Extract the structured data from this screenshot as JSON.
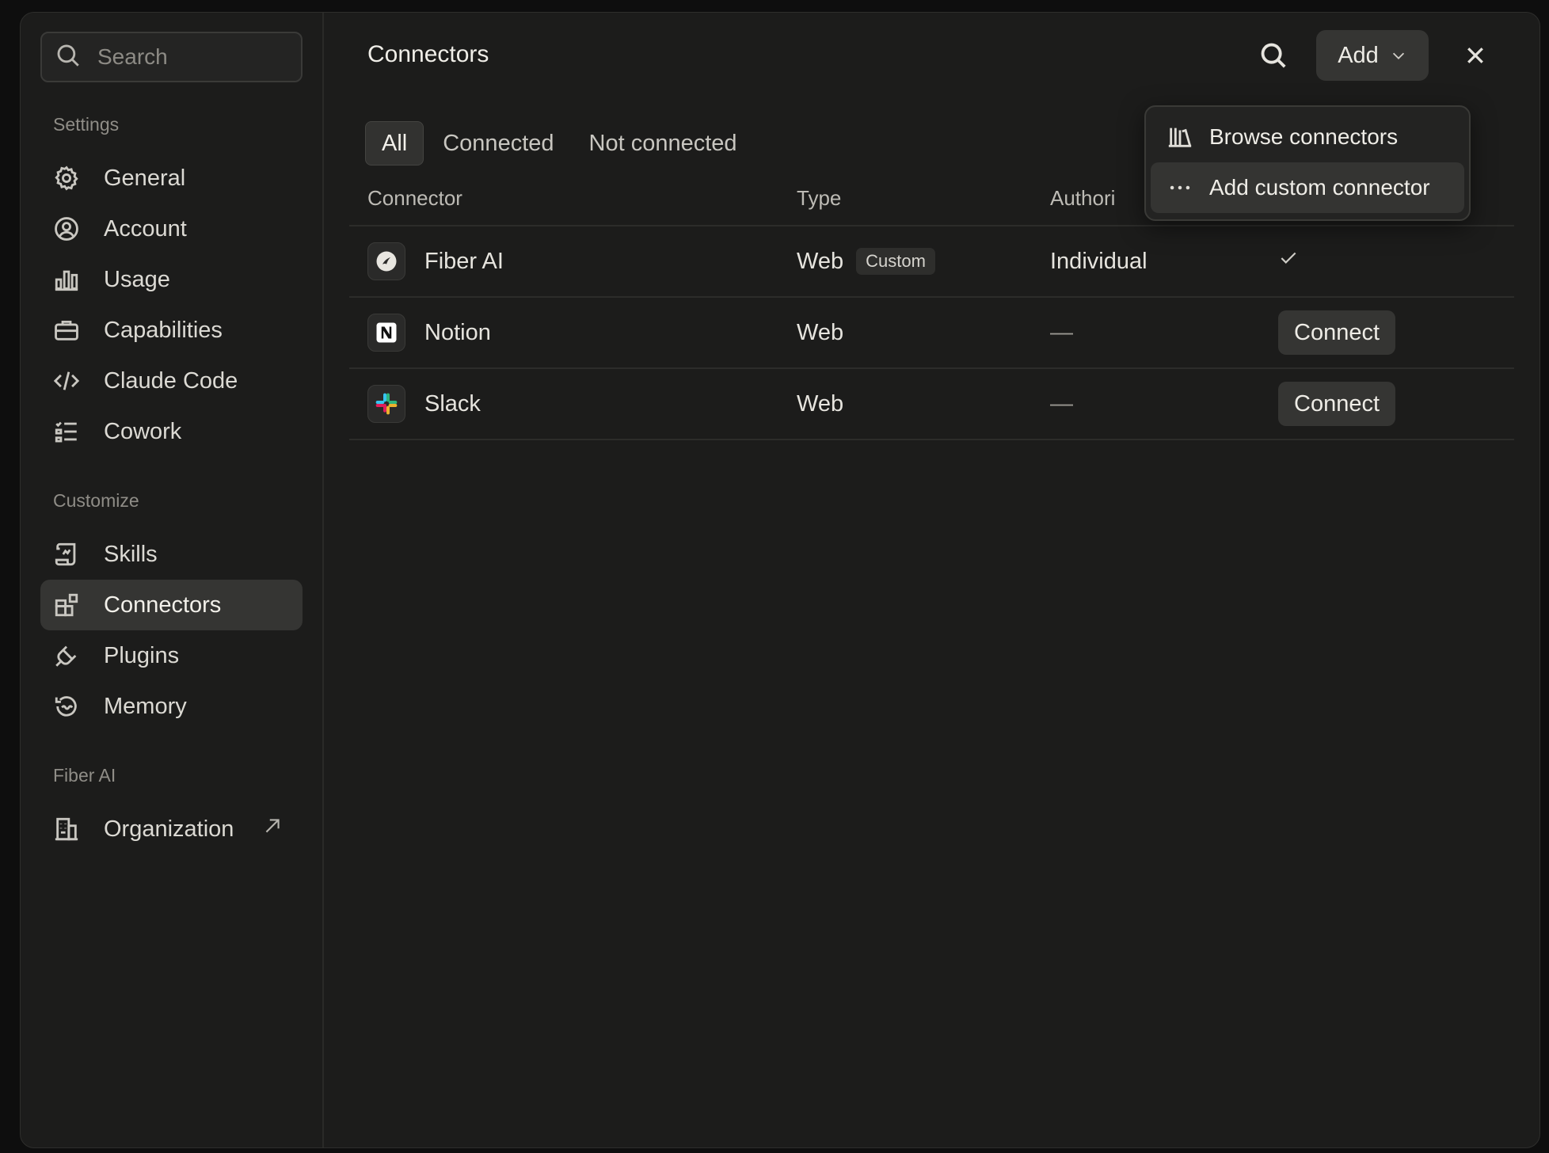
{
  "sidebar": {
    "search_placeholder": "Search",
    "sections": [
      {
        "label": "Settings",
        "items": [
          {
            "label": "General",
            "icon": "gear-icon"
          },
          {
            "label": "Account",
            "icon": "user-circle-icon"
          },
          {
            "label": "Usage",
            "icon": "bar-chart-icon"
          },
          {
            "label": "Capabilities",
            "icon": "briefcase-icon"
          },
          {
            "label": "Claude Code",
            "icon": "code-icon"
          },
          {
            "label": "Cowork",
            "icon": "checklist-icon"
          }
        ]
      },
      {
        "label": "Customize",
        "items": [
          {
            "label": "Skills",
            "icon": "scroll-icon"
          },
          {
            "label": "Connectors",
            "icon": "connectors-icon",
            "active": true
          },
          {
            "label": "Plugins",
            "icon": "plug-icon"
          },
          {
            "label": "Memory",
            "icon": "memory-icon"
          }
        ]
      },
      {
        "label": "Fiber AI",
        "items": [
          {
            "label": "Organization",
            "icon": "building-icon",
            "external": true
          }
        ]
      }
    ]
  },
  "main": {
    "title": "Connectors",
    "add_label": "Add",
    "tabs": [
      {
        "label": "All",
        "active": true
      },
      {
        "label": "Connected"
      },
      {
        "label": "Not connected"
      }
    ],
    "table": {
      "headers": [
        "Connector",
        "Type",
        "Authori"
      ],
      "rows": [
        {
          "name": "Fiber AI",
          "type": "Web",
          "badge": "Custom",
          "auth": "Individual",
          "status": "connected"
        },
        {
          "name": "Notion",
          "type": "Web",
          "auth": "—",
          "action": "Connect"
        },
        {
          "name": "Slack",
          "type": "Web",
          "auth": "—",
          "action": "Connect"
        }
      ]
    },
    "dropdown": {
      "items": [
        {
          "label": "Browse connectors",
          "icon": "library-icon"
        },
        {
          "label": "Add custom connector",
          "icon": "more-horizontal-icon"
        }
      ]
    }
  },
  "colors": {
    "background": "#1c1c1b",
    "active_item": "#353533",
    "text": "#e6e4de"
  }
}
